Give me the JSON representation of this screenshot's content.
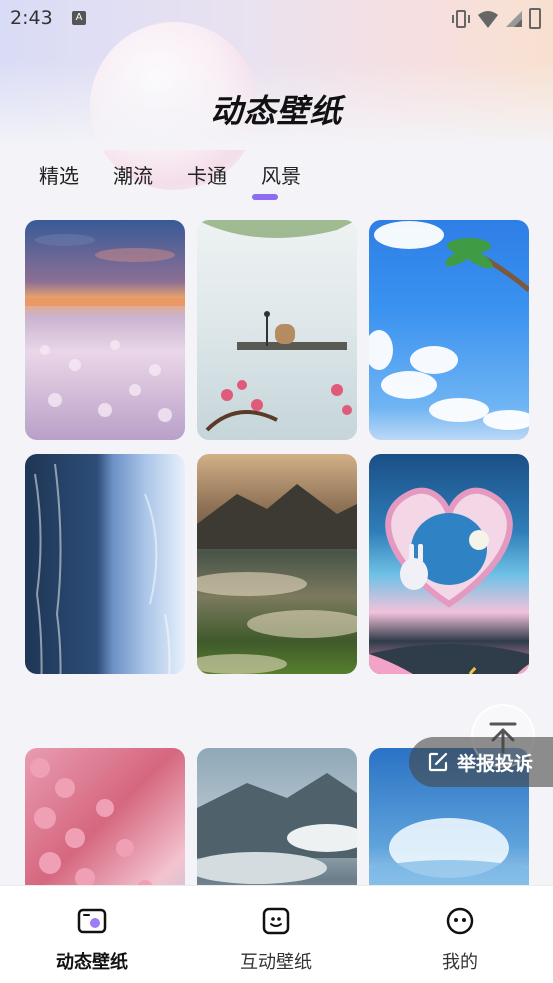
{
  "status_bar": {
    "time": "2:43"
  },
  "header": {
    "title": "动态壁纸"
  },
  "tabs": [
    {
      "label": "精选"
    },
    {
      "label": "潮流"
    },
    {
      "label": "卡通"
    },
    {
      "label": "风景"
    }
  ],
  "active_tab": "风景",
  "accent_color": "#8b6cf2",
  "wallpapers": [
    "flower-field-sunset",
    "boat-on-misty-lake",
    "palm-tree-blue-sky",
    "ocean-waves-aerial",
    "misty-mountain-valley",
    "cartoon-rabbit-heart-clouds",
    "pink-rose-wall",
    "mountain-peaks-clouds",
    "underwater-light"
  ],
  "report_button": {
    "label": "举报投诉"
  },
  "bottom_nav": [
    {
      "label": "动态壁纸",
      "icon": "dynamic-wallpaper-icon"
    },
    {
      "label": "互动壁纸",
      "icon": "interactive-wallpaper-icon"
    },
    {
      "label": "我的",
      "icon": "profile-face-icon"
    }
  ]
}
